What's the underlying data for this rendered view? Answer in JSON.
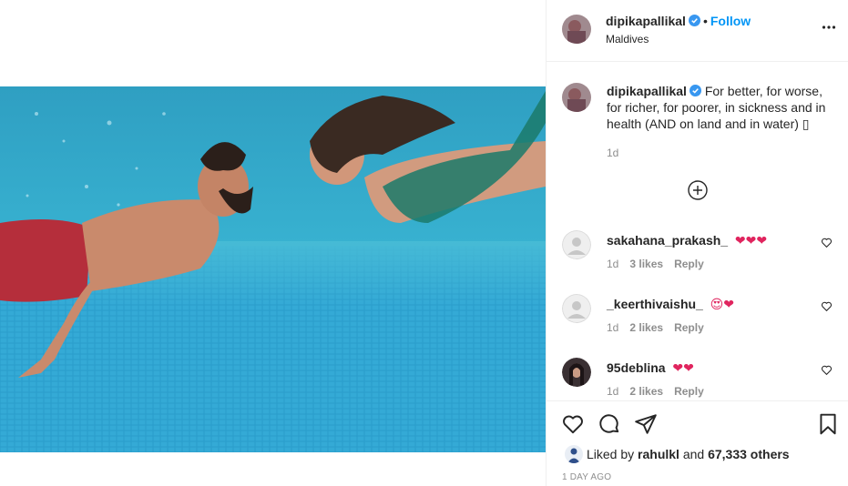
{
  "post": {
    "username": "dipikapallikal",
    "follow_label": "Follow",
    "location": "Maldives",
    "caption": "For better, for worse, for richer, for poorer, in sickness and in health (AND on land and in water) ▯",
    "caption_age": "1d"
  },
  "comments": [
    {
      "username": "sakahana_prakash_",
      "text": "❤❤❤",
      "age": "1d",
      "likes": "3 likes",
      "reply": "Reply"
    },
    {
      "username": "_keerthivaishu_",
      "text": "😍❤",
      "age": "1d",
      "likes": "2 likes",
      "reply": "Reply"
    },
    {
      "username": "95deblina",
      "text": "❤❤",
      "age": "1d",
      "likes": "2 likes",
      "reply": "Reply"
    }
  ],
  "footer": {
    "liked_prefix": "Liked by",
    "liked_user": "rahulkl",
    "liked_mid": "and",
    "liked_count": "67,333 others",
    "timestamp": "1 DAY AGO"
  },
  "icons": {
    "verified": "verified-badge-icon",
    "more": "more-options-icon",
    "load_more": "plus-circle-icon",
    "heart": "heart-outline-icon",
    "comment": "comment-bubble-icon",
    "share": "paper-plane-icon",
    "save": "bookmark-icon"
  },
  "colors": {
    "accent": "#0095f6",
    "water": "#3fb0cf",
    "heart_red": "#e0245e"
  }
}
